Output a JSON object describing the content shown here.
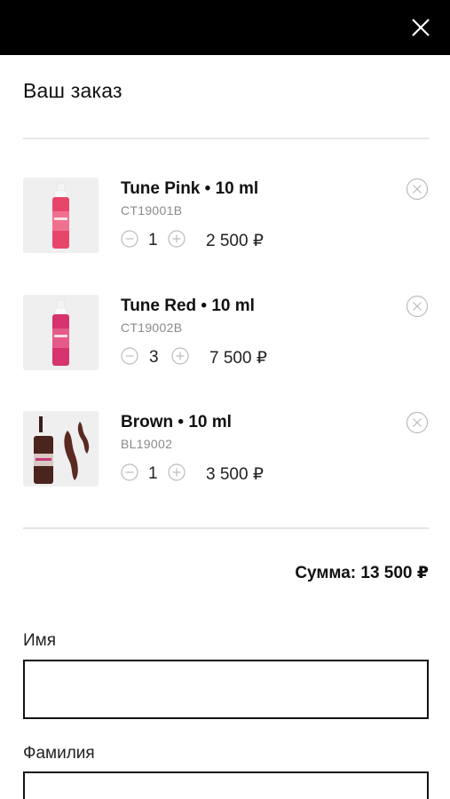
{
  "header": {
    "close_icon": "close-icon"
  },
  "title": "Ваш заказ",
  "cart": {
    "items": [
      {
        "name": "Tune Pink • 10 ml",
        "sku": "CT19001B",
        "qty": "1",
        "price": "2 500 ₽"
      },
      {
        "name": "Tune Red • 10 ml",
        "sku": "CT19002B",
        "qty": "3",
        "price": "7 500 ₽"
      },
      {
        "name": "Brown • 10 ml",
        "sku": "BL19002",
        "qty": "1",
        "price": "3 500 ₽"
      }
    ],
    "total": "Сумма: 13 500 ₽"
  },
  "form": {
    "first_name_label": "Имя",
    "first_name_value": "",
    "last_name_label": "Фамилия",
    "last_name_value": ""
  },
  "colors": {
    "topbar": "#000000",
    "pink_bottle": "#e8456a",
    "red_bottle": "#d6336f",
    "brown": "#5a2a22"
  }
}
